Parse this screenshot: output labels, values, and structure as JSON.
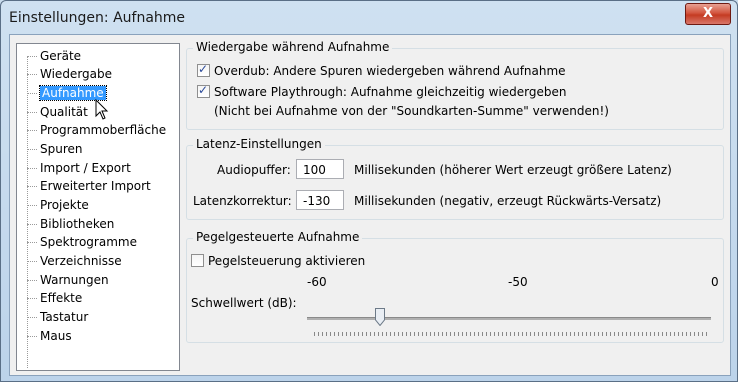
{
  "window": {
    "title": "Einstellungen: Aufnahme",
    "close_label": "X"
  },
  "tree": {
    "items": [
      {
        "label": "Geräte"
      },
      {
        "label": "Wiedergabe"
      },
      {
        "label": "Aufnahme",
        "selected": true
      },
      {
        "label": "Qualität"
      },
      {
        "label": "Programmoberfläche"
      },
      {
        "label": "Spuren"
      },
      {
        "label": "Import / Export"
      },
      {
        "label": "Erweiterter Import"
      },
      {
        "label": "Projekte"
      },
      {
        "label": "Bibliotheken"
      },
      {
        "label": "Spektrogramme"
      },
      {
        "label": "Verzeichnisse"
      },
      {
        "label": "Warnungen"
      },
      {
        "label": "Effekte"
      },
      {
        "label": "Tastatur"
      },
      {
        "label": "Maus"
      }
    ]
  },
  "playback": {
    "title": "Wiedergabe während Aufnahme",
    "overdub_label": "Overdub: Andere Spuren wiedergeben während Aufnahme",
    "overdub_checked": true,
    "playthrough_label": "Software Playthrough: Aufnahme gleichzeitig wiedergeben",
    "playthrough_checked": true,
    "playthrough_note": "(Nicht bei Aufnahme von der \"Soundkarten-Summe\" verwenden!)"
  },
  "latency": {
    "title": "Latenz-Einstellungen",
    "buffer_label": "Audiopuffer:",
    "buffer_value": "100",
    "buffer_hint": "Millisekunden (höherer Wert erzeugt größere Latenz)",
    "correction_label": "Latenzkorrektur:",
    "correction_value": "-130",
    "correction_hint": "Millisekunden (negativ, erzeugt Rückwärts-Versatz)"
  },
  "level": {
    "title": "Pegelgesteuerte Aufnahme",
    "enable_label": "Pegelsteuerung aktivieren",
    "enable_checked": false,
    "scale_min": "-60",
    "scale_mid": "-50",
    "scale_max": "0",
    "threshold_label": "Schwellwert (dB):",
    "threshold_value": -50
  }
}
